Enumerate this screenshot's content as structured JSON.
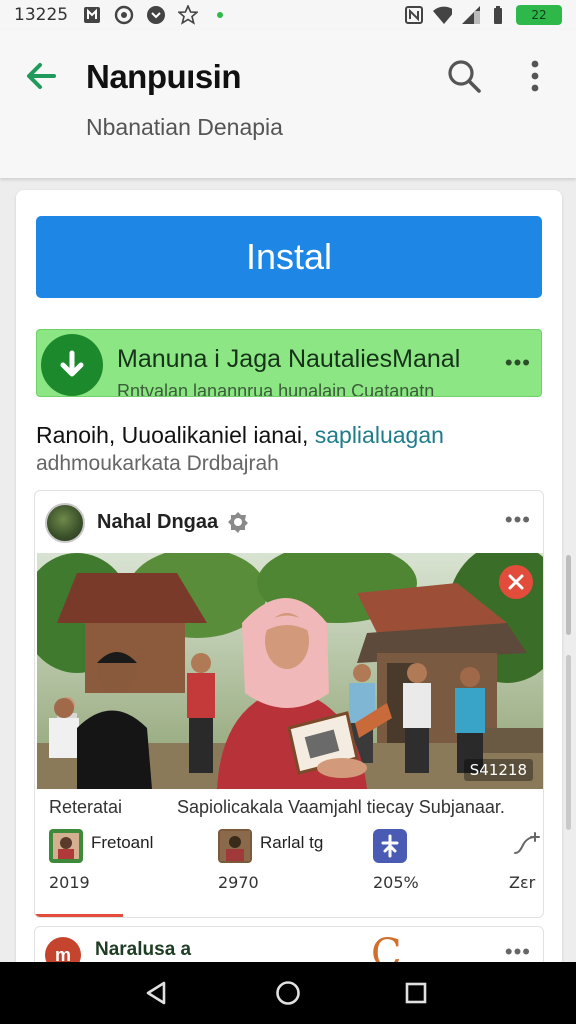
{
  "status_bar": {
    "time": "13225",
    "battery_label": "22",
    "icons": [
      "notification-icon",
      "app-icon",
      "chat-icon",
      "star-icon",
      "dot-icon",
      "nfc-icon",
      "wifi-icon",
      "signal-icon",
      "battery-icon"
    ]
  },
  "app_bar": {
    "title": "Nanpuısin",
    "subtitle": "Nbanatian Denapia",
    "accent": "#1f9a5a"
  },
  "card": {
    "install_label": "Instal",
    "install_color": "#1e87e5",
    "download": {
      "title": "Manuna i Jaga NautaliesManal",
      "subtitle": "Rntvalan lanannrua hunalain Cuatanatn",
      "more": "•••"
    },
    "description": {
      "text": "Ranoih, Uuoalikaniel ianai,",
      "link": "saplialuagan",
      "secondary": "adhmoukarkata Drdbajrah"
    },
    "post": {
      "author": "Nahal Dngaa",
      "more": "•••",
      "photo_count": "S41218",
      "caption_left": "Reteratai",
      "caption_right": "Sapiolicakala Vaamjahl tiecay Subjanaar.",
      "stats": [
        {
          "label": "Fretoanl",
          "value": "2019"
        },
        {
          "label": "Rarlal tg",
          "value": "2970"
        },
        {
          "label": "",
          "value": "205%"
        },
        {
          "label": "",
          "value": "Zεr"
        }
      ]
    },
    "post2": {
      "author": "Naralusa a",
      "avatar_letter": "m",
      "more": "•••"
    }
  }
}
